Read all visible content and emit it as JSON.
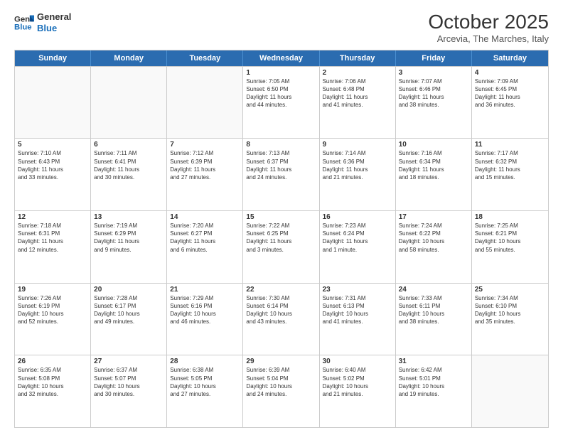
{
  "header": {
    "logo_line1": "General",
    "logo_line2": "Blue",
    "month": "October 2025",
    "location": "Arcevia, The Marches, Italy"
  },
  "days_of_week": [
    "Sunday",
    "Monday",
    "Tuesday",
    "Wednesday",
    "Thursday",
    "Friday",
    "Saturday"
  ],
  "weeks": [
    [
      {
        "day": "",
        "info": ""
      },
      {
        "day": "",
        "info": ""
      },
      {
        "day": "",
        "info": ""
      },
      {
        "day": "1",
        "info": "Sunrise: 7:05 AM\nSunset: 6:50 PM\nDaylight: 11 hours\nand 44 minutes."
      },
      {
        "day": "2",
        "info": "Sunrise: 7:06 AM\nSunset: 6:48 PM\nDaylight: 11 hours\nand 41 minutes."
      },
      {
        "day": "3",
        "info": "Sunrise: 7:07 AM\nSunset: 6:46 PM\nDaylight: 11 hours\nand 38 minutes."
      },
      {
        "day": "4",
        "info": "Sunrise: 7:09 AM\nSunset: 6:45 PM\nDaylight: 11 hours\nand 36 minutes."
      }
    ],
    [
      {
        "day": "5",
        "info": "Sunrise: 7:10 AM\nSunset: 6:43 PM\nDaylight: 11 hours\nand 33 minutes."
      },
      {
        "day": "6",
        "info": "Sunrise: 7:11 AM\nSunset: 6:41 PM\nDaylight: 11 hours\nand 30 minutes."
      },
      {
        "day": "7",
        "info": "Sunrise: 7:12 AM\nSunset: 6:39 PM\nDaylight: 11 hours\nand 27 minutes."
      },
      {
        "day": "8",
        "info": "Sunrise: 7:13 AM\nSunset: 6:37 PM\nDaylight: 11 hours\nand 24 minutes."
      },
      {
        "day": "9",
        "info": "Sunrise: 7:14 AM\nSunset: 6:36 PM\nDaylight: 11 hours\nand 21 minutes."
      },
      {
        "day": "10",
        "info": "Sunrise: 7:16 AM\nSunset: 6:34 PM\nDaylight: 11 hours\nand 18 minutes."
      },
      {
        "day": "11",
        "info": "Sunrise: 7:17 AM\nSunset: 6:32 PM\nDaylight: 11 hours\nand 15 minutes."
      }
    ],
    [
      {
        "day": "12",
        "info": "Sunrise: 7:18 AM\nSunset: 6:31 PM\nDaylight: 11 hours\nand 12 minutes."
      },
      {
        "day": "13",
        "info": "Sunrise: 7:19 AM\nSunset: 6:29 PM\nDaylight: 11 hours\nand 9 minutes."
      },
      {
        "day": "14",
        "info": "Sunrise: 7:20 AM\nSunset: 6:27 PM\nDaylight: 11 hours\nand 6 minutes."
      },
      {
        "day": "15",
        "info": "Sunrise: 7:22 AM\nSunset: 6:25 PM\nDaylight: 11 hours\nand 3 minutes."
      },
      {
        "day": "16",
        "info": "Sunrise: 7:23 AM\nSunset: 6:24 PM\nDaylight: 11 hours\nand 1 minute."
      },
      {
        "day": "17",
        "info": "Sunrise: 7:24 AM\nSunset: 6:22 PM\nDaylight: 10 hours\nand 58 minutes."
      },
      {
        "day": "18",
        "info": "Sunrise: 7:25 AM\nSunset: 6:21 PM\nDaylight: 10 hours\nand 55 minutes."
      }
    ],
    [
      {
        "day": "19",
        "info": "Sunrise: 7:26 AM\nSunset: 6:19 PM\nDaylight: 10 hours\nand 52 minutes."
      },
      {
        "day": "20",
        "info": "Sunrise: 7:28 AM\nSunset: 6:17 PM\nDaylight: 10 hours\nand 49 minutes."
      },
      {
        "day": "21",
        "info": "Sunrise: 7:29 AM\nSunset: 6:16 PM\nDaylight: 10 hours\nand 46 minutes."
      },
      {
        "day": "22",
        "info": "Sunrise: 7:30 AM\nSunset: 6:14 PM\nDaylight: 10 hours\nand 43 minutes."
      },
      {
        "day": "23",
        "info": "Sunrise: 7:31 AM\nSunset: 6:13 PM\nDaylight: 10 hours\nand 41 minutes."
      },
      {
        "day": "24",
        "info": "Sunrise: 7:33 AM\nSunset: 6:11 PM\nDaylight: 10 hours\nand 38 minutes."
      },
      {
        "day": "25",
        "info": "Sunrise: 7:34 AM\nSunset: 6:10 PM\nDaylight: 10 hours\nand 35 minutes."
      }
    ],
    [
      {
        "day": "26",
        "info": "Sunrise: 6:35 AM\nSunset: 5:08 PM\nDaylight: 10 hours\nand 32 minutes."
      },
      {
        "day": "27",
        "info": "Sunrise: 6:37 AM\nSunset: 5:07 PM\nDaylight: 10 hours\nand 30 minutes."
      },
      {
        "day": "28",
        "info": "Sunrise: 6:38 AM\nSunset: 5:05 PM\nDaylight: 10 hours\nand 27 minutes."
      },
      {
        "day": "29",
        "info": "Sunrise: 6:39 AM\nSunset: 5:04 PM\nDaylight: 10 hours\nand 24 minutes."
      },
      {
        "day": "30",
        "info": "Sunrise: 6:40 AM\nSunset: 5:02 PM\nDaylight: 10 hours\nand 21 minutes."
      },
      {
        "day": "31",
        "info": "Sunrise: 6:42 AM\nSunset: 5:01 PM\nDaylight: 10 hours\nand 19 minutes."
      },
      {
        "day": "",
        "info": ""
      }
    ]
  ]
}
